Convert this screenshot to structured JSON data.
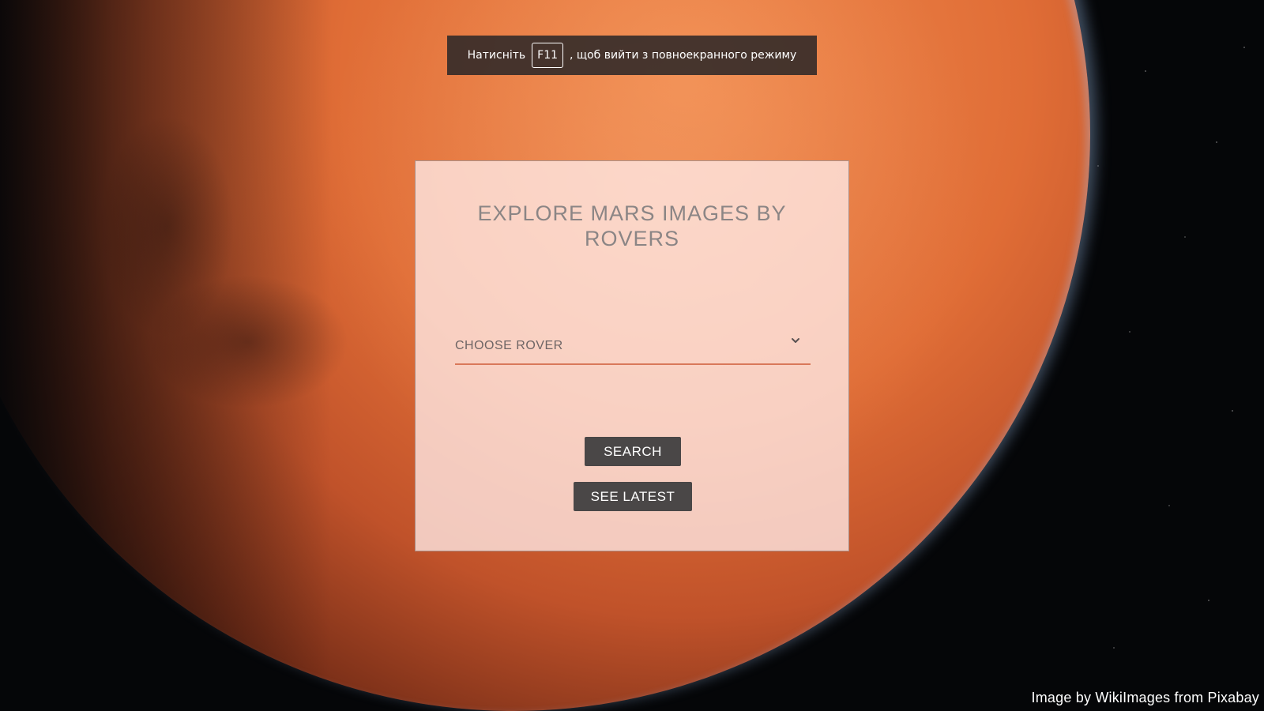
{
  "fullscreen_notice": {
    "prefix": "Натисніть",
    "key": "F11",
    "suffix": ", щоб вийти з повноекранного режиму"
  },
  "card": {
    "title": "EXPLORE MARS IMAGES BY ROVERS",
    "rover_select": {
      "selected_label": "CHOOSE ROVER",
      "icon": "chevron-down-icon"
    },
    "search_button_label": "SEARCH",
    "see_latest_button_label": "SEE LATEST"
  },
  "background": {
    "description_icon": "mars-planet-background"
  },
  "footer": {
    "credit": "Image by WikiImages from Pixabay"
  },
  "colors": {
    "button_bg": "#4a4747",
    "select_underline": "#d9785a",
    "card_bg": "#ffebe8"
  }
}
